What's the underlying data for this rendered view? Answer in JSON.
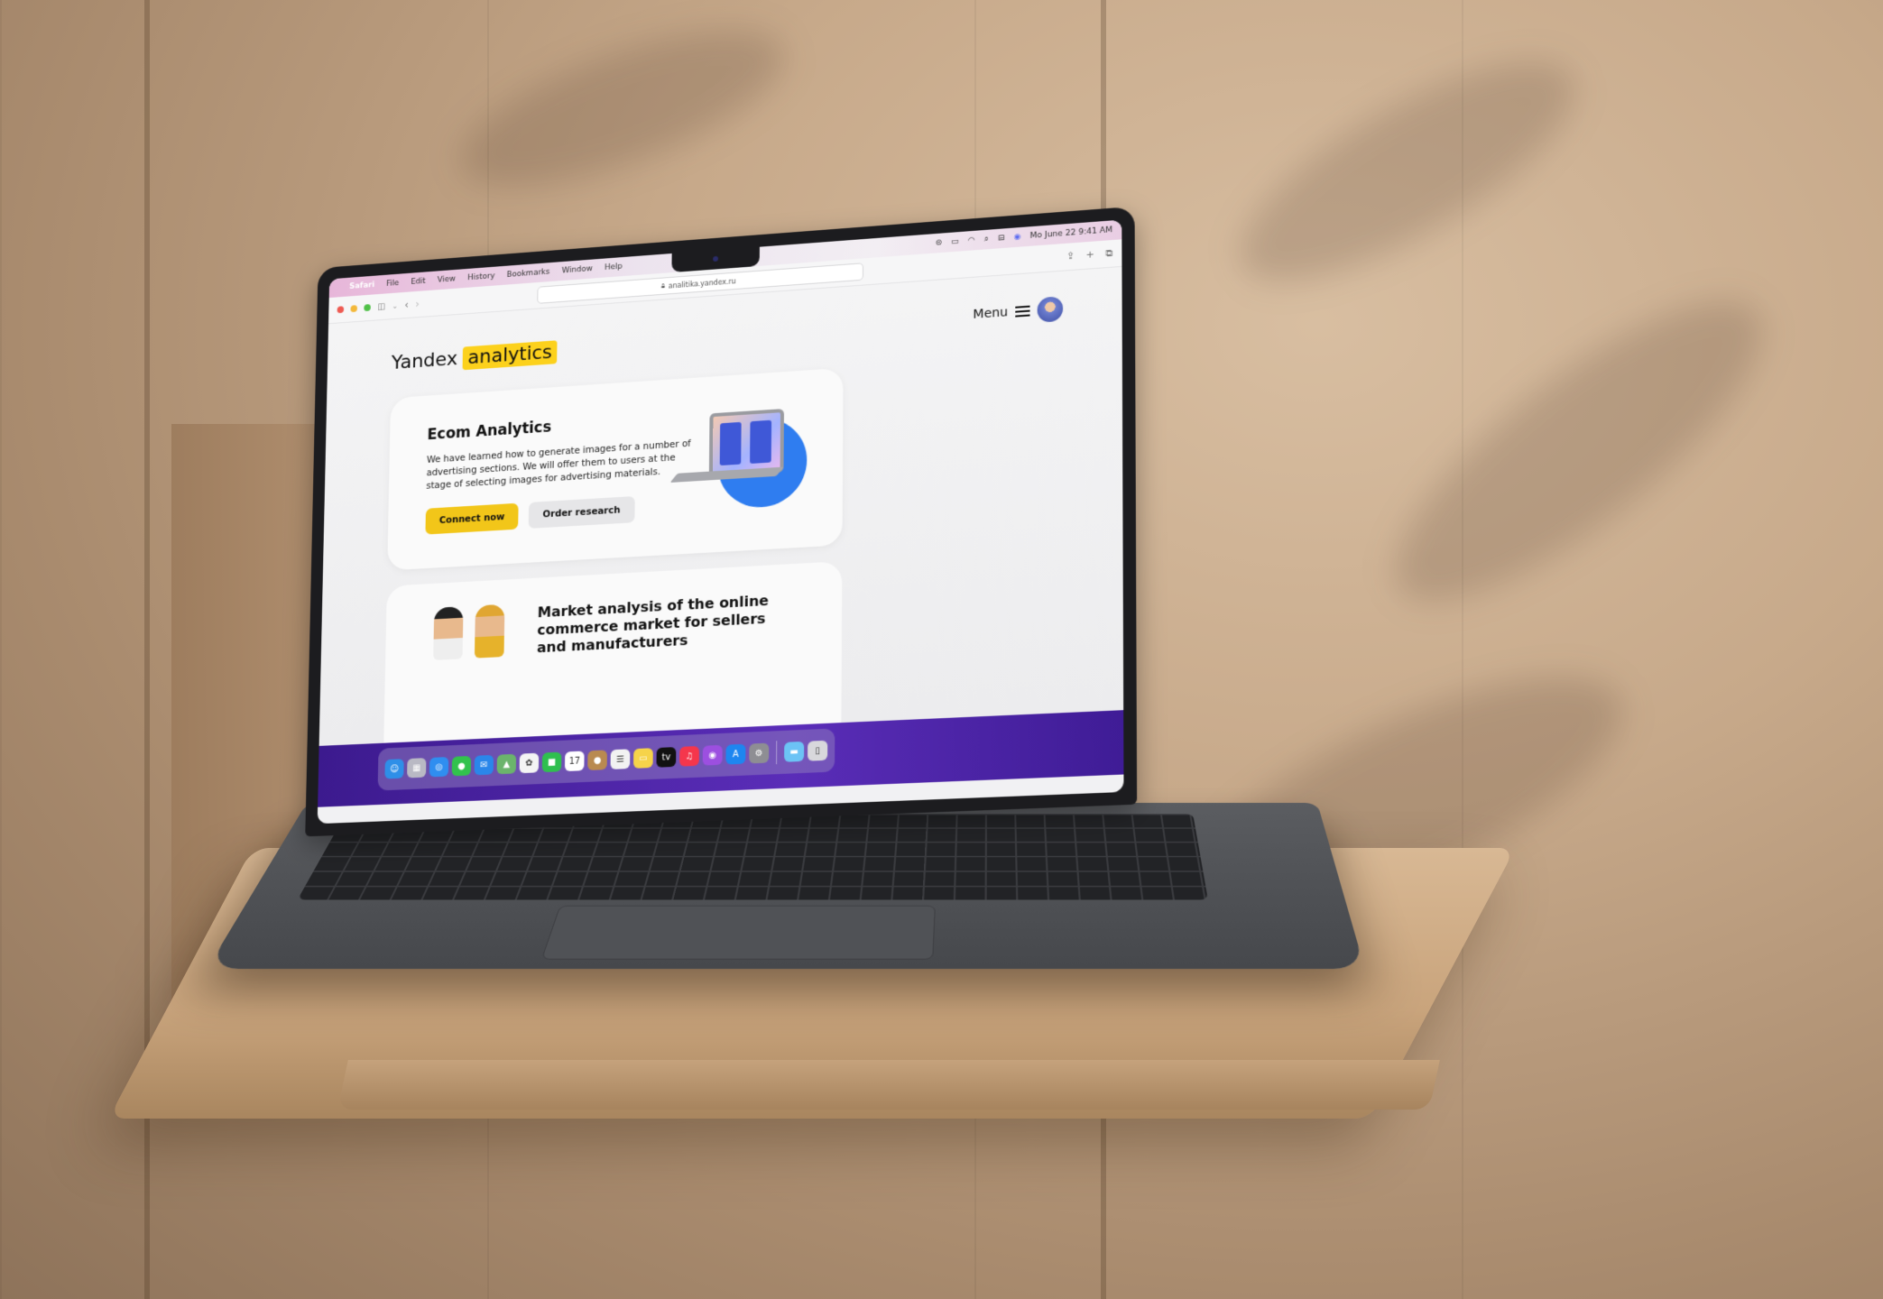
{
  "os_menubar": {
    "apple_icon": "apple-icon",
    "app_name": "Safari",
    "menus": [
      "File",
      "Edit",
      "View",
      "History",
      "Bookmarks",
      "Window",
      "Help"
    ],
    "status_icons": [
      "screen-record-icon",
      "battery-icon",
      "wifi-icon",
      "search-icon",
      "control-center-icon",
      "siri-icon"
    ],
    "datetime": "Mo June 22  9:41 AM"
  },
  "browser": {
    "url": "analitika.yandex.ru",
    "lock_icon": "lock-icon",
    "toolbar_left_icons": [
      "sidebar-icon",
      "chevron-down-icon",
      "back-icon",
      "forward-icon"
    ],
    "toolbar_right_icons": [
      "share-icon",
      "new-tab-icon",
      "tabs-icon"
    ]
  },
  "site": {
    "logo": {
      "brand": "Yandex",
      "highlight": "analytics"
    },
    "menu_label": "Menu",
    "colors": {
      "accent_yellow": "#f2c619",
      "illustration_blue": "#2f7df0",
      "dock_purple": "#4b23a8"
    },
    "hero_card": {
      "title": "Ecom Analytics",
      "description": "We have learned how to generate images for a number of advertising sections. We will offer them to users at the stage of selecting images for advertising materials.",
      "primary_button": "Connect now",
      "secondary_button": "Order research"
    },
    "second_card": {
      "title": "Market analysis of the online commerce market for sellers and manufacturers"
    }
  },
  "dock": {
    "apps": [
      {
        "name": "Finder",
        "icon": "finder-icon",
        "glyph": "☺",
        "color": "#2e8fe8"
      },
      {
        "name": "Launchpad",
        "icon": "launchpad-icon",
        "glyph": "▦",
        "color": "#b9b9c4"
      },
      {
        "name": "Safari",
        "icon": "safari-icon",
        "glyph": "◎",
        "color": "#2f8ef0"
      },
      {
        "name": "Messages",
        "icon": "messages-icon",
        "glyph": "●",
        "color": "#32c24d"
      },
      {
        "name": "Mail",
        "icon": "mail-icon",
        "glyph": "✉",
        "color": "#2a86ea"
      },
      {
        "name": "Maps",
        "icon": "maps-icon",
        "glyph": "▲",
        "color": "#6bb46c"
      },
      {
        "name": "Photos",
        "icon": "photos-icon",
        "glyph": "✿",
        "color": "#f4f4f4"
      },
      {
        "name": "FaceTime",
        "icon": "facetime-icon",
        "glyph": "■",
        "color": "#2fbf4f"
      },
      {
        "name": "Calendar",
        "icon": "calendar-icon",
        "glyph": "17",
        "color": "#ffffff"
      },
      {
        "name": "Contacts",
        "icon": "contacts-icon",
        "glyph": "●",
        "color": "#b98a50"
      },
      {
        "name": "Reminders",
        "icon": "reminders-icon",
        "glyph": "☰",
        "color": "#f2f2f2"
      },
      {
        "name": "Notes",
        "icon": "notes-icon",
        "glyph": "▭",
        "color": "#f6d34a"
      },
      {
        "name": "TV",
        "icon": "apple-tv-icon",
        "glyph": "tv",
        "color": "#111111"
      },
      {
        "name": "Music",
        "icon": "music-icon",
        "glyph": "♫",
        "color": "#f5364c"
      },
      {
        "name": "Podcasts",
        "icon": "podcasts-icon",
        "glyph": "◉",
        "color": "#9c4fe0"
      },
      {
        "name": "App Store",
        "icon": "app-store-icon",
        "glyph": "A",
        "color": "#1e86f0"
      },
      {
        "name": "System Preferences",
        "icon": "system-preferences-icon",
        "glyph": "⚙",
        "color": "#8e8e93"
      }
    ],
    "extras": [
      {
        "name": "Downloads",
        "icon": "folder-icon",
        "glyph": "▬",
        "color": "#6cc3f5"
      },
      {
        "name": "Trash",
        "icon": "trash-icon",
        "glyph": "▯",
        "color": "#d8d8dc"
      }
    ]
  }
}
